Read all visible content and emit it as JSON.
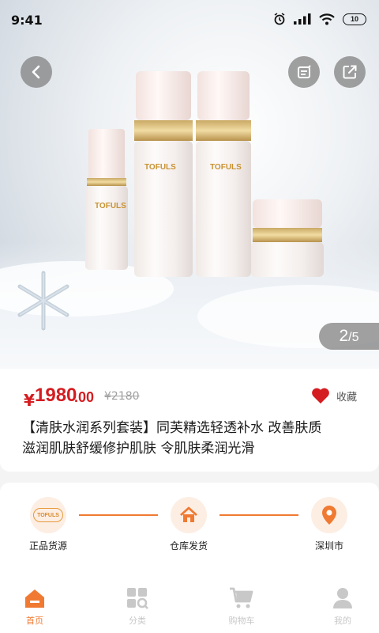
{
  "status": {
    "time": "9:41",
    "battery": "10"
  },
  "gallery": {
    "current": "2",
    "total": "/5"
  },
  "product": {
    "currency": "¥",
    "price_int": "1980",
    "price_dec": ".00",
    "old_price": "¥2180",
    "favorite_label": "收藏",
    "title_line1": "【清肤水润系列套装】同芙精选轻透补水 改善肤质",
    "title_line2": "滋润肌肤舒缓修护肌肤 令肌肤柔润光滑",
    "brand": "TOFULS"
  },
  "shipping": {
    "steps": [
      {
        "label": "正品货源",
        "icon": "brand-logo-icon"
      },
      {
        "label": "仓库发货",
        "icon": "home-icon"
      },
      {
        "label": "深圳市",
        "icon": "location-pin-icon"
      }
    ]
  },
  "tabbar": {
    "tabs": [
      {
        "label": "首页",
        "icon": "home-icon",
        "active": true
      },
      {
        "label": "分类",
        "icon": "category-icon",
        "active": false
      },
      {
        "label": "购物车",
        "icon": "cart-icon",
        "active": false
      },
      {
        "label": "我的",
        "icon": "profile-icon",
        "active": false
      }
    ]
  },
  "colors": {
    "accent": "#f07a32",
    "price": "#d41d21",
    "tab_inactive": "#c8c8c8"
  }
}
